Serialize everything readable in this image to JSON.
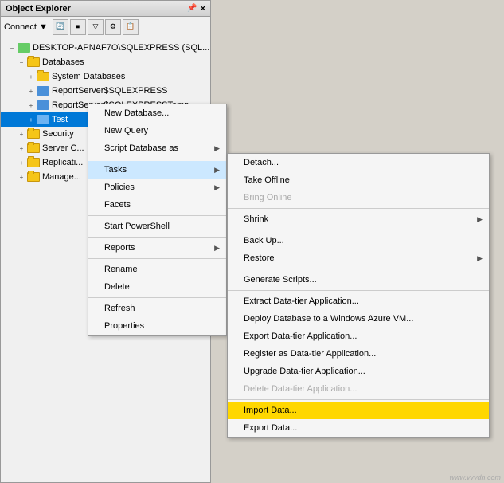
{
  "panel": {
    "title": "Object Explorer",
    "close_label": "×",
    "pin_label": "📌"
  },
  "toolbar": {
    "connect_label": "Connect ▼"
  },
  "tree": {
    "server": "DESKTOP-APNAF7O\\SQLEXPRESS (SQL...",
    "items": [
      {
        "label": "Databases",
        "level": 1,
        "expanded": true
      },
      {
        "label": "System Databases",
        "level": 2
      },
      {
        "label": "ReportServer$SQLEXPRESS",
        "level": 2
      },
      {
        "label": "ReportServer$SQLEXPRESSTemp...",
        "level": 2
      },
      {
        "label": "Test",
        "level": 2,
        "selected": true
      },
      {
        "label": "Security",
        "level": 1
      },
      {
        "label": "Server C...",
        "level": 1
      },
      {
        "label": "Replicati...",
        "level": 1
      },
      {
        "label": "Manage...",
        "level": 1
      }
    ]
  },
  "context_menu": {
    "items": [
      {
        "label": "New Database...",
        "has_arrow": false
      },
      {
        "label": "New Query",
        "has_arrow": false
      },
      {
        "label": "Script Database as",
        "has_arrow": true
      },
      {
        "label": "Tasks",
        "has_arrow": true,
        "active": true
      },
      {
        "label": "Policies",
        "has_arrow": true
      },
      {
        "label": "Facets",
        "has_arrow": false
      },
      {
        "label": "Start PowerShell",
        "has_arrow": false
      },
      {
        "label": "Reports",
        "has_arrow": true
      },
      {
        "label": "Rename",
        "has_arrow": false
      },
      {
        "label": "Delete",
        "has_arrow": false
      },
      {
        "label": "Refresh",
        "has_arrow": false
      },
      {
        "label": "Properties",
        "has_arrow": false
      }
    ]
  },
  "tasks_submenu": {
    "items": [
      {
        "label": "Detach...",
        "disabled": false
      },
      {
        "label": "Take Offline",
        "disabled": false
      },
      {
        "label": "Bring Online",
        "disabled": true
      },
      {
        "label": "Shrink",
        "has_arrow": true,
        "disabled": false
      },
      {
        "label": "Back Up...",
        "disabled": false
      },
      {
        "label": "Restore",
        "has_arrow": true,
        "disabled": false
      },
      {
        "label": "Generate Scripts...",
        "disabled": false
      },
      {
        "separator": true
      },
      {
        "label": "Extract Data-tier Application...",
        "disabled": false
      },
      {
        "label": "Deploy Database to a Windows Azure VM...",
        "disabled": false
      },
      {
        "label": "Export Data-tier Application...",
        "disabled": false
      },
      {
        "label": "Register as Data-tier Application...",
        "disabled": false
      },
      {
        "label": "Upgrade Data-tier Application...",
        "disabled": false
      },
      {
        "label": "Delete Data-tier Application...",
        "disabled": true
      },
      {
        "separator": true
      },
      {
        "label": "Import Data...",
        "highlighted": true,
        "disabled": false
      },
      {
        "label": "Export Data...",
        "disabled": false
      }
    ]
  },
  "watermark": "www.vvvdn.com"
}
